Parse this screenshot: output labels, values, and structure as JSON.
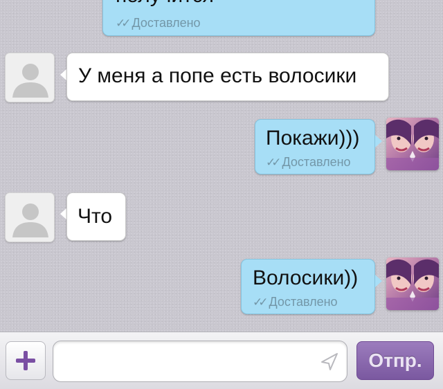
{
  "messages": [
    {
      "direction": "out",
      "text": "получится",
      "status": "Доставлено"
    },
    {
      "direction": "in",
      "text": "У меня а попе есть волосики"
    },
    {
      "direction": "out",
      "text": "Покажи)))",
      "status": "Доставлено"
    },
    {
      "direction": "in",
      "text": "Что"
    },
    {
      "direction": "out",
      "text": "Волосики))",
      "status": "Доставлено"
    }
  ],
  "input_bar": {
    "plus_icon": "plus-icon",
    "placeholder": "",
    "send_icon": "send-arrow-icon",
    "send_label": "Отпр."
  },
  "colors": {
    "outgoing_bubble": "#a7def6",
    "incoming_bubble": "#ffffff",
    "status_text": "#7397a8",
    "accent": "#7a58a0"
  }
}
